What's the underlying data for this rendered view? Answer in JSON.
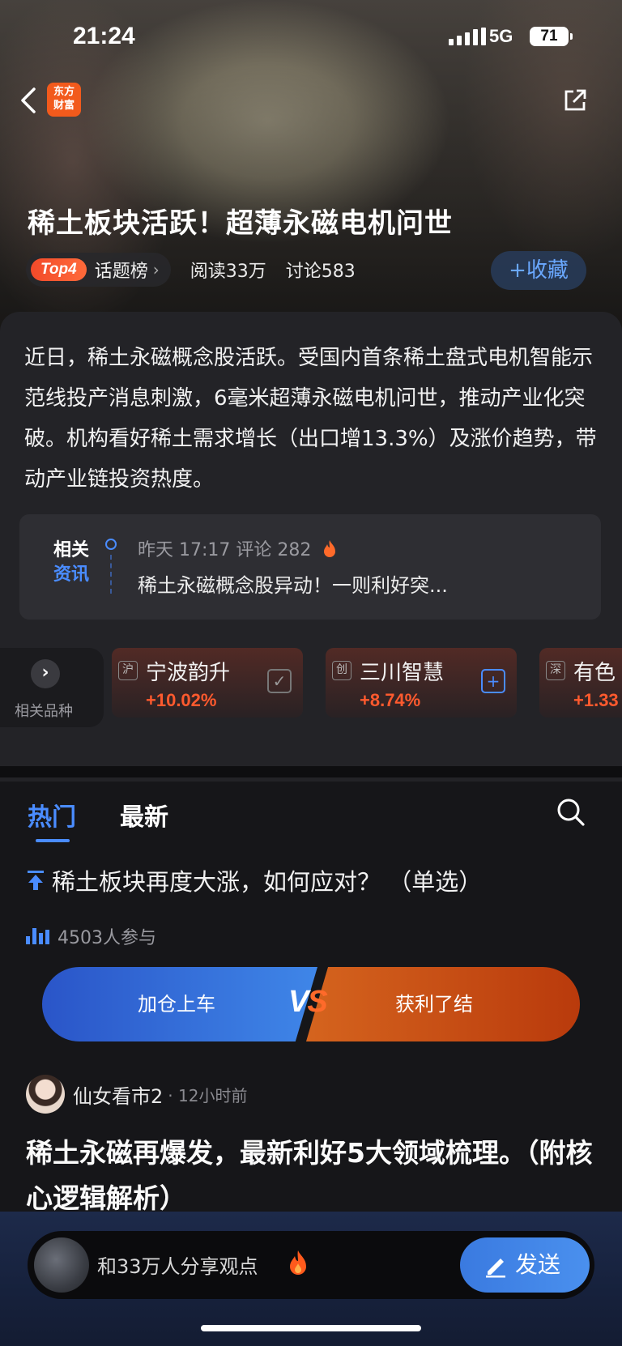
{
  "status": {
    "time": "21:24",
    "network": "5G",
    "battery": "71"
  },
  "header": {
    "logo_line1": "东方",
    "logo_line2": "财富",
    "title": "稀土板块活跃！超薄永磁电机问世",
    "top_badge": "Top4",
    "topic_label": "话题榜",
    "reads": "阅读33万",
    "discussions": "讨论583",
    "favorite_label": "+收藏"
  },
  "summary": {
    "text": "近日，稀土永磁概念股活跃。受国内首条稀土盘式电机智能示范线投产消息刺激，6毫米超薄永磁电机问世，推动产业化突破。机构看好稀土需求增长（出口增13.3%）及涨价趋势，带动产业链投资热度。"
  },
  "related_news": {
    "tag_line1": "相关",
    "tag_line2": "资讯",
    "meta": "昨天 17:17  评论 282",
    "title": "稀土永磁概念股异动！一则利好突..."
  },
  "related_products": {
    "label": "相关品种",
    "items": [
      {
        "market": "沪",
        "name": "宁波韵升",
        "change": "+10.02%",
        "action": "✓"
      },
      {
        "market": "创",
        "name": "三川智慧",
        "change": "+8.74%",
        "action": "+"
      },
      {
        "market": "深",
        "name": "有色",
        "change": "+1.33"
      }
    ]
  },
  "tabs": {
    "hot": "热门",
    "latest": "最新"
  },
  "poll": {
    "question": "稀土板块再度大涨，如何应对？ （单选）",
    "participants": "4503人参与",
    "option_a": "加仓上车",
    "vs_v": "V",
    "vs_s": "S",
    "option_b": "获利了结"
  },
  "post": {
    "author": "仙女看市2",
    "time": "· 12小时前",
    "title": "稀土永磁再爆发，最新利好5大领域梳理。（附核心逻辑解析）"
  },
  "composer": {
    "placeholder": "和33万人分享观点",
    "send_label": "发送"
  },
  "colors": {
    "accent_blue": "#4a8cff",
    "rise_red": "#ff5a2e",
    "brand_orange": "#f25a1c"
  }
}
